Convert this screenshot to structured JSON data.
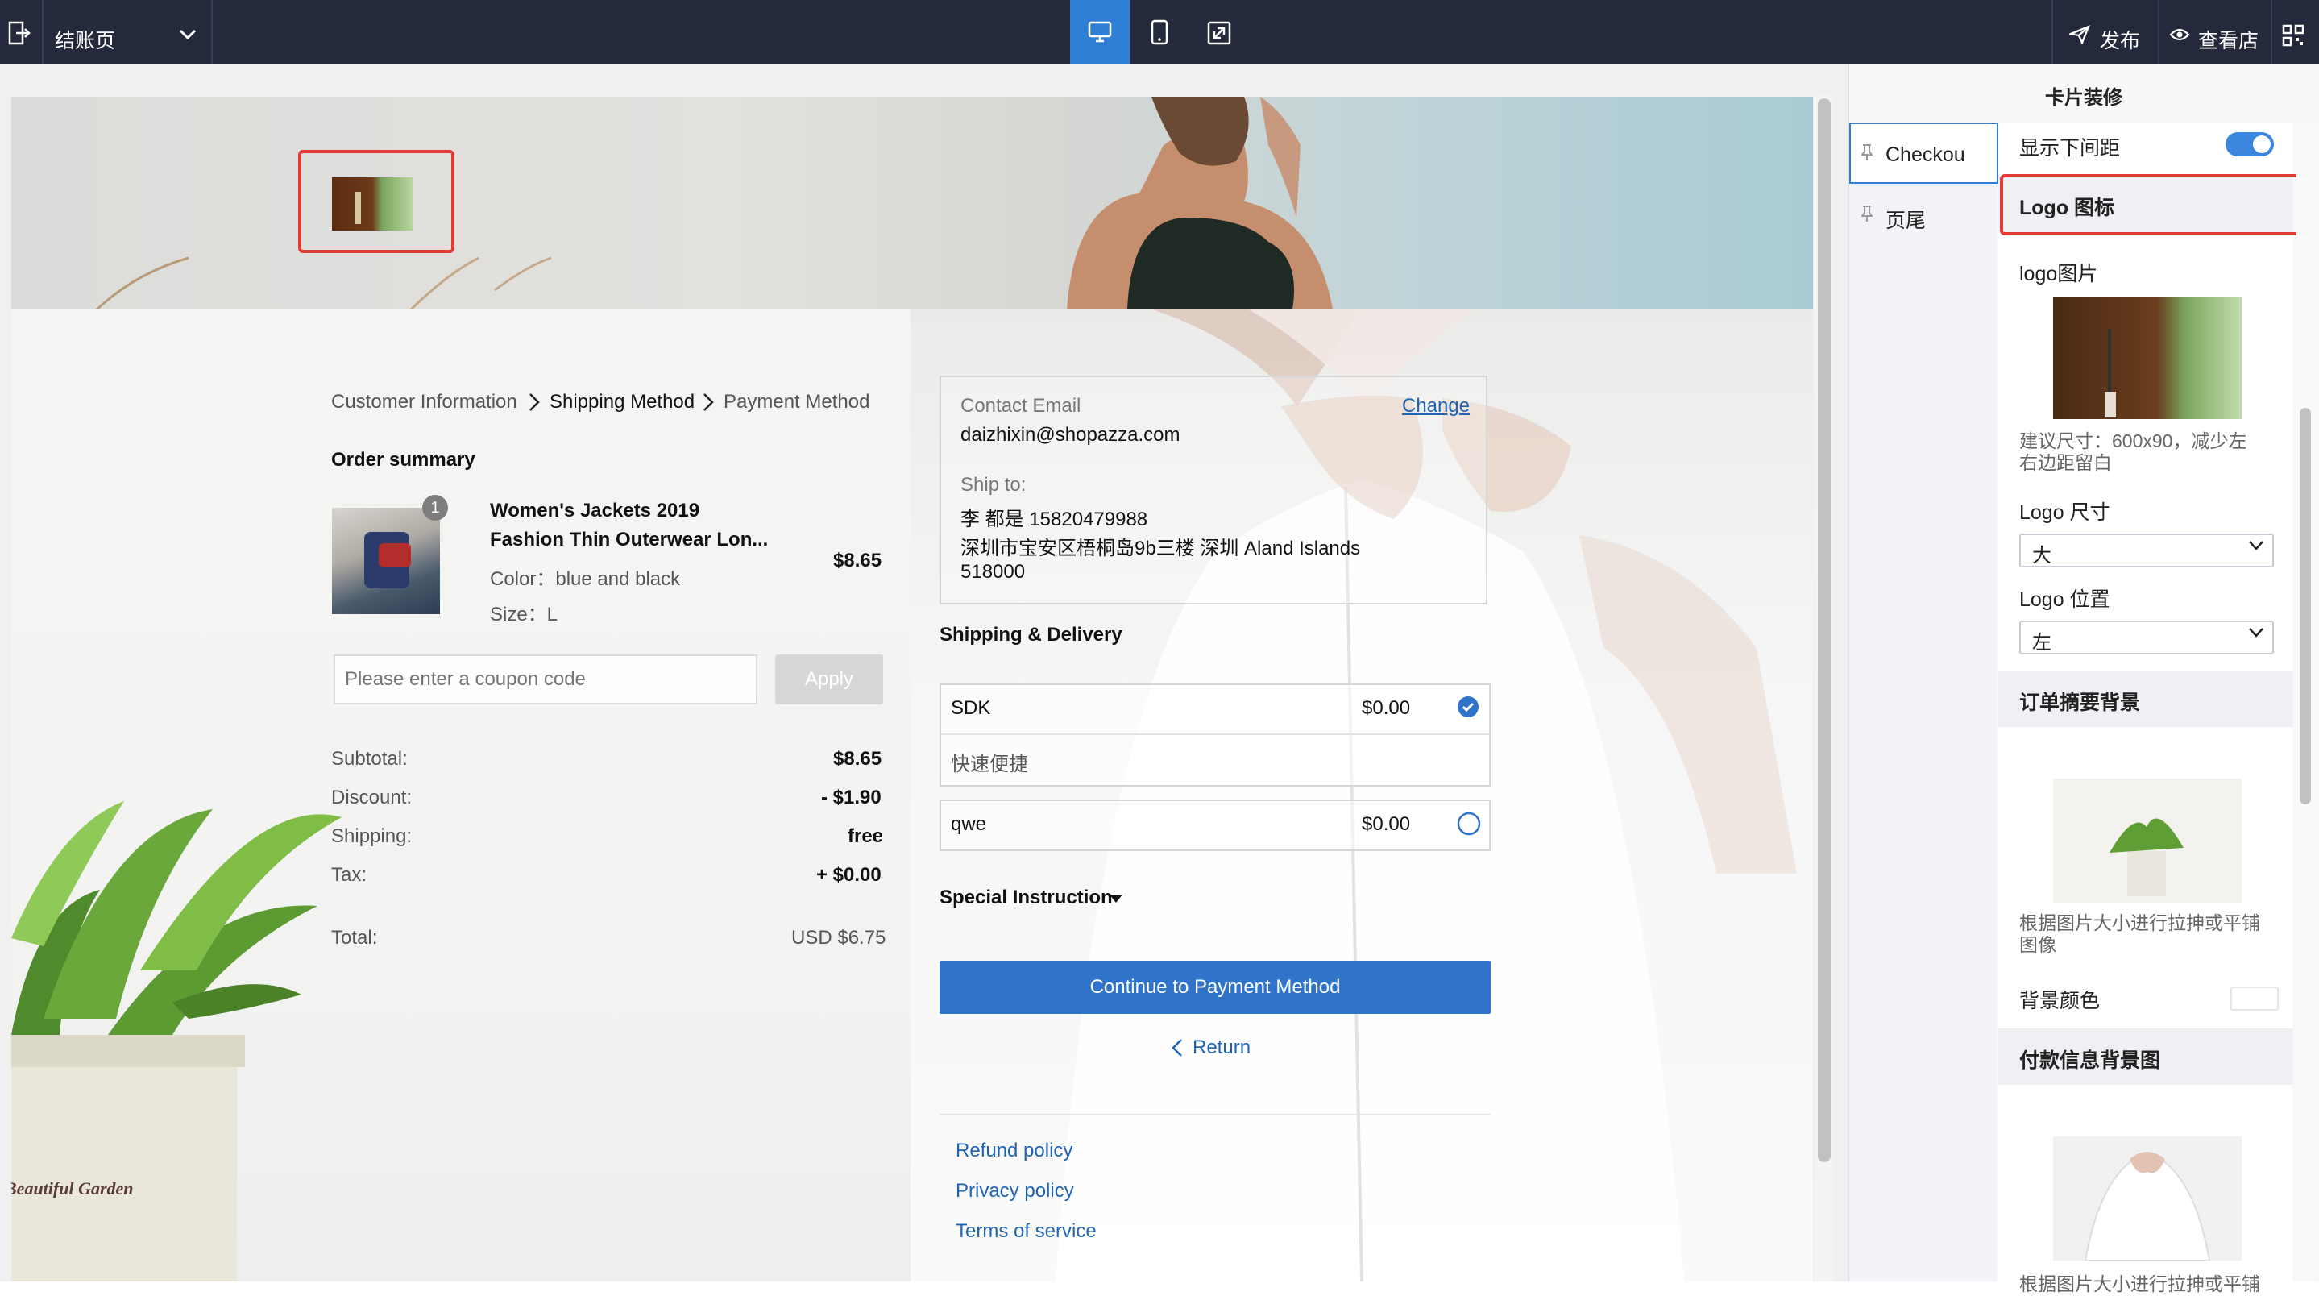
{
  "topbar": {
    "page_select": "结账页",
    "publish": "发布",
    "view_store": "查看店"
  },
  "header": {},
  "breadcrumb": {
    "step1": "Customer Information",
    "step2": "Shipping Method",
    "step3": "Payment Method"
  },
  "order": {
    "title": "Order summary",
    "item": {
      "qty": "1",
      "name_line1": "Women's Jackets 2019",
      "name_line2": "Fashion Thin Outerwear Lon...",
      "color": "Color：blue and black",
      "size": "Size：L",
      "price": "$8.65"
    },
    "coupon_placeholder": "Please enter a coupon code",
    "apply": "Apply",
    "subtotal_label": "Subtotal:",
    "subtotal_value": "$8.65",
    "discount_label": "Discount:",
    "discount_value": "- $1.90",
    "shipping_label": "Shipping:",
    "shipping_value": "free",
    "tax_label": "Tax:",
    "tax_value": "+ $0.00",
    "total_label": "Total:",
    "total_value": "USD $6.75"
  },
  "contact": {
    "email_label": "Contact Email",
    "email": "daizhixin@shopazza.com",
    "change": "Change",
    "ship_label": "Ship to:",
    "ship_line1": "李  都是  15820479988",
    "ship_line2": "深圳市宝安区梧桐岛9b三楼   深圳   Aland Islands",
    "ship_line3": "518000"
  },
  "shipping": {
    "title": "Shipping & Delivery",
    "options": [
      {
        "name": "SDK",
        "price": "$0.00",
        "desc": "快速便捷",
        "selected": true
      },
      {
        "name": "qwe",
        "price": "$0.00",
        "selected": false
      }
    ],
    "special": "Special Instruction",
    "continue": "Continue to Payment Method",
    "return": "Return"
  },
  "footer_links": [
    "Refund policy",
    "Privacy policy",
    "Terms of service"
  ],
  "watermark": "Beautiful Garden",
  "sidebar": {
    "tab_checkout": "Checkou",
    "tab_footer": "页尾"
  },
  "settings": {
    "title": "卡片装修",
    "show_bottom_spacing": "显示下间距",
    "toggle_on": true,
    "logo_section": "Logo 图标",
    "logo_image_label": "logo图片",
    "logo_hint": "建议尺寸：600x90，减少左右边距留白",
    "logo_hint_l1": "建议尺寸：600x90，减少左",
    "logo_hint_l2": "右边距留白",
    "logo_size_label": "Logo 尺寸",
    "logo_size_value": "大",
    "logo_pos_label": "Logo 位置",
    "logo_pos_value": "左",
    "order_bg_section": "订单摘要背景",
    "stretch_hint_l1": "根据图片大小进行拉抻或平铺",
    "stretch_hint_l2": "图像",
    "bg_color_label": "背景颜色",
    "payment_bg_section": "付款信息背景图",
    "stretch_hint_cut": "根据图片大小进行拉抻或平铺"
  },
  "colors": {
    "topbar": "#242a3c",
    "active_device": "#2f7fd7",
    "primary_button": "#2f74c8",
    "link": "#1f64b3",
    "highlight_red": "#e23a37"
  }
}
